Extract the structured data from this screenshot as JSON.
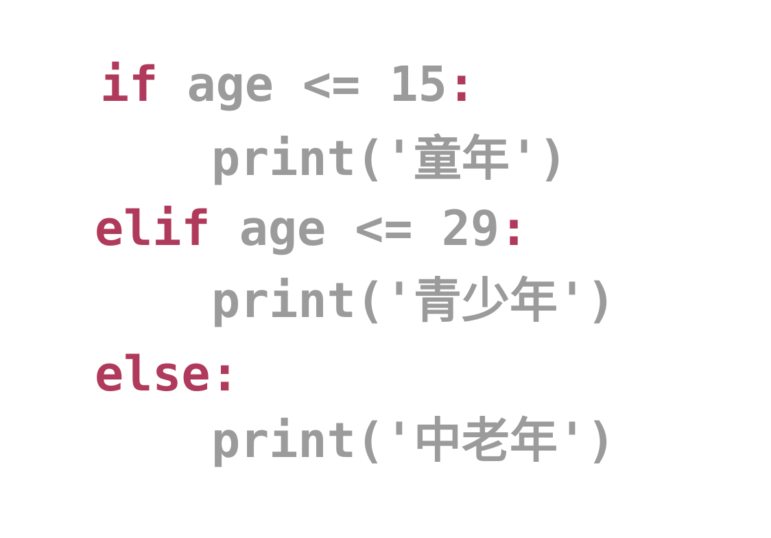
{
  "colors": {
    "keyword": "#b03a5b",
    "text": "#9b9b9b",
    "background": "#ffffff"
  },
  "lines": [
    {
      "keyword": "if",
      "text": " age <= 15",
      "colon": ":"
    },
    {
      "text": "print('童年')"
    },
    {
      "keyword": "elif",
      "text": " age <= 29",
      "colon": ":"
    },
    {
      "text": "print('青少年')"
    },
    {
      "keyword": "else",
      "colon": ":"
    },
    {
      "text": "print('中老年')"
    }
  ]
}
